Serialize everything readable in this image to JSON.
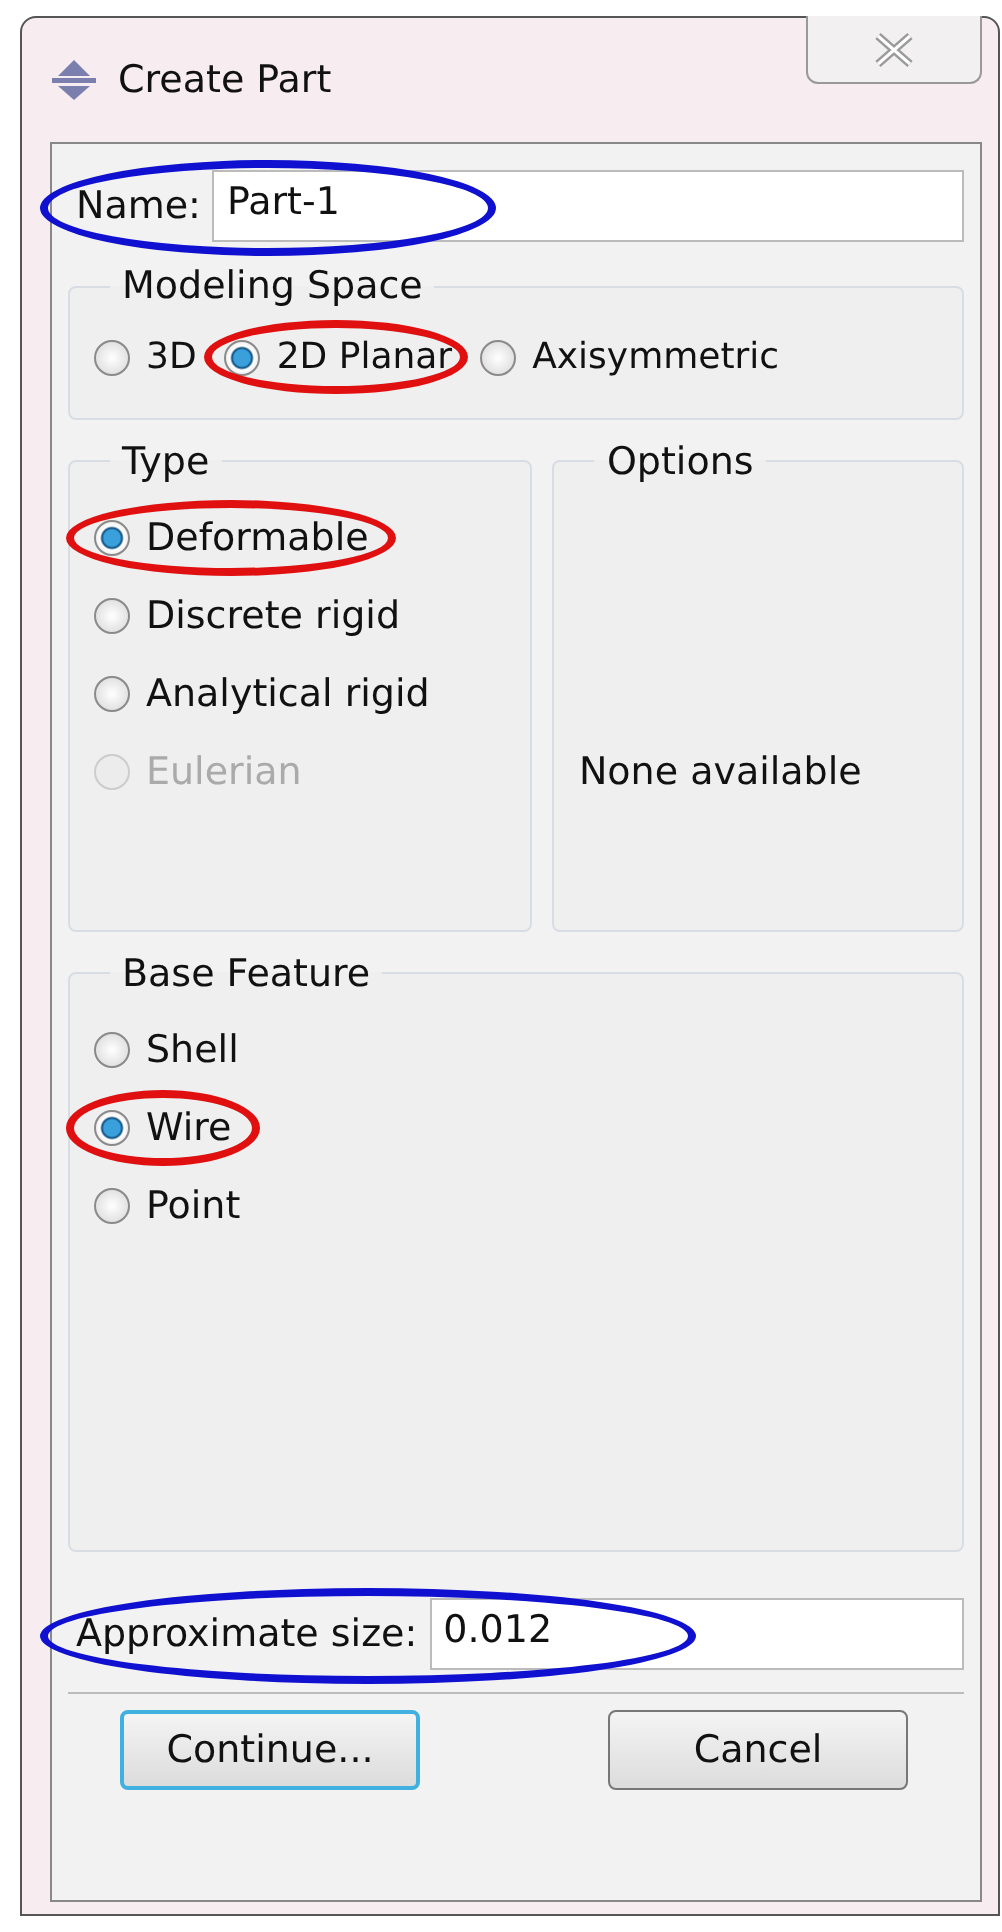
{
  "window": {
    "title": "Create Part"
  },
  "name_field": {
    "label": "Name:",
    "value": "Part-1",
    "color": "#1010d0"
  },
  "modeling_space": {
    "title": "Modeling Space",
    "options": [
      {
        "label": "3D",
        "selected": false,
        "disabled": false
      },
      {
        "label": "2D Planar",
        "selected": true,
        "disabled": false,
        "color": "#e01010"
      },
      {
        "label": "Axisymmetric",
        "selected": false,
        "disabled": false
      }
    ]
  },
  "type": {
    "title": "Type",
    "options": [
      {
        "label": "Deformable",
        "selected": true,
        "disabled": false,
        "color": "#e01010"
      },
      {
        "label": "Discrete rigid",
        "selected": false,
        "disabled": false
      },
      {
        "label": "Analytical rigid",
        "selected": false,
        "disabled": false
      },
      {
        "label": "Eulerian",
        "selected": false,
        "disabled": true
      }
    ]
  },
  "options": {
    "title": "Options",
    "text": "None available"
  },
  "base_feature": {
    "title": "Base Feature",
    "options": [
      {
        "label": "Shell",
        "selected": false,
        "disabled": false
      },
      {
        "label": "Wire",
        "selected": true,
        "disabled": false,
        "color": "#e01010"
      },
      {
        "label": "Point",
        "selected": false,
        "disabled": false
      }
    ]
  },
  "size_field": {
    "label": "Approximate size:",
    "value": "0.012",
    "color": "#1010d0"
  },
  "buttons": [
    {
      "label": "Continue...",
      "default": true
    },
    {
      "label": "Cancel",
      "default": false
    }
  ]
}
